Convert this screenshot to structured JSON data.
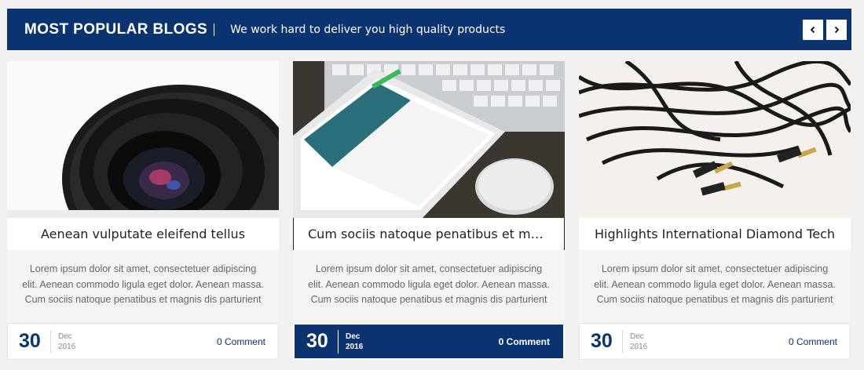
{
  "header": {
    "title": "MOST POPULAR BLOGS",
    "subtitle": "We work hard to deliver you high quality products",
    "prev_icon": "chevron-left-icon",
    "next_icon": "chevron-right-icon",
    "accent_color": "#0a3370"
  },
  "posts": [
    {
      "title": "Aenean vulputate eleifend tellus",
      "excerpt": "Lorem ipsum dolor sit amet, consectetuer adipiscing elit. Aenean commodo ligula eget dolor. Aenean massa. Cum sociis natoque penatibus et magnis dis parturient",
      "day": "30",
      "month": "Dec",
      "year": "2016",
      "comments": "0 Comment",
      "image": "camera-lens-photo"
    },
    {
      "title": "Cum sociis natoque penatibus et magnis",
      "excerpt": "Lorem ipsum dolor sit amet, consectetuer adipiscing elit. Aenean commodo ligula eget dolor. Aenean massa. Cum sociis natoque penatibus et magnis dis parturient",
      "day": "30",
      "month": "Dec",
      "year": "2016",
      "comments": "0 Comment",
      "image": "tablet-keyboard-photo"
    },
    {
      "title": "Highlights International Diamond Tech",
      "excerpt": "Lorem ipsum dolor sit amet, consectetuer adipiscing elit. Aenean commodo ligula eget dolor. Aenean massa. Cum sociis natoque penatibus et magnis dis parturient",
      "day": "30",
      "month": "Dec",
      "year": "2016",
      "comments": "0 Comment",
      "image": "audio-cables-photo"
    }
  ]
}
